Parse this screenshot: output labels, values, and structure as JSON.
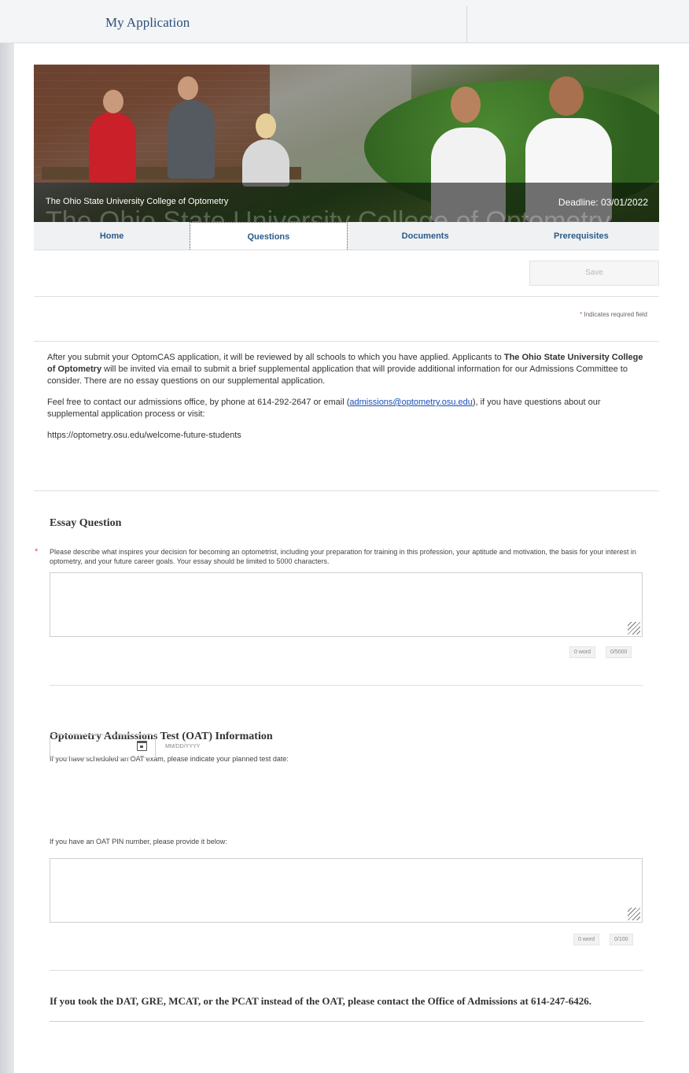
{
  "topbar": {
    "title": "My Application"
  },
  "hero": {
    "school": "The Ohio State University College of Optometry",
    "deadline": "Deadline: 03/01/2022",
    "ghost_text": "The Ohio State University College of Optometry"
  },
  "tabs": [
    {
      "label": "Home"
    },
    {
      "label": "Questions"
    },
    {
      "label": "Documents"
    },
    {
      "label": "Prerequisites"
    }
  ],
  "save_label": "Save",
  "required_note": {
    "star": "*",
    "text": "Indicates required field"
  },
  "intro": {
    "p1_a": "After you submit your OptomCAS application, it will be reviewed by all schools to which you have applied. Applicants to ",
    "p1_bold": "The Ohio State University College of Optometry",
    "p1_b": " will be invited via email to submit a brief supplemental application that will provide additional information for our Admissions Committee to consider.  There are no essay questions on our supplemental application.",
    "p2_a": "Feel free to contact our admissions office, by phone at 614-292-2647 or email (",
    "p2_link": "admissions@optometry.osu.edu",
    "p2_b": "), if you have questions about our supplemental application process or visit:",
    "p3": "https://optometry.osu.edu/welcome-future-students"
  },
  "essay": {
    "title": "Essay Question",
    "star": "*",
    "question": "Please describe what inspires your decision for becoming an optometrist, including your preparation for training in this profession, your aptitude and motivation, the basis for your interest in optometry, and your future career goals. Your essay should be limited to 5000 characters.",
    "word_count": "0 word",
    "char_count": "0/5000"
  },
  "oat": {
    "title": "Optometry Admissions Test (OAT) Information",
    "date_prompt": "If you have scheduled an OAT exam, please indicate your planned test date:",
    "date_format": "MM/DD/YYYY",
    "pin_prompt": "If you have an OAT PIN number, please provide it below:",
    "word_count": "0 word",
    "char_count": "0/100"
  },
  "final_note": "If you took the DAT, GRE, MCAT, or the PCAT instead of the OAT, please contact the Office of Admissions at 614-247-6426."
}
